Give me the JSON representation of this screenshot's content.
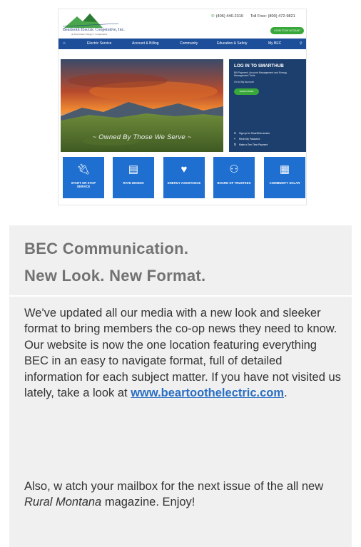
{
  "site": {
    "logo_name": "Beartooth Electric Cooperative, Inc.",
    "logo_tagline": "A Touchstone Energy® Cooperative",
    "phone": "(406) 446-2310",
    "toll_free": "Toll Free: (800) 472-9821",
    "login_label": "LOGIN TO MY ACCOUNT",
    "nav": [
      "Electric Service",
      "Account & Billing",
      "Community",
      "Education & Safety",
      "My BEC"
    ],
    "hero_caption": "~ Owned By Those We Serve ~",
    "smarthub": {
      "title": "LOG IN TO SMARTHUB",
      "description": "Bill Payment, Account Management and Energy Management Tools",
      "goto": "Go to My Account",
      "learn": "LEARN MORE",
      "links": [
        "Sign up for SmartHub access",
        "Reset My Password",
        "Make a One-Time Payment"
      ]
    },
    "tiles": [
      {
        "label": "START OR STOP SERVICE",
        "icon": "plug-icon"
      },
      {
        "label": "RATE DESIGN",
        "icon": "document-icon"
      },
      {
        "label": "ENERGY ASSISTANCE",
        "icon": "heart-hand-icon"
      },
      {
        "label": "BOARD OF TRUSTEES",
        "icon": "group-icon"
      },
      {
        "label": "COMMUNITY SOLAR",
        "icon": "solar-panel-icon"
      }
    ],
    "colors": {
      "nav": "#1c4e9a",
      "tile": "#1e6fd0",
      "accent_green": "#39a83a",
      "panel": "#1d3f6d"
    }
  },
  "article": {
    "heading_line1": "BEC Communication.",
    "heading_line2": "New Look. New Format.",
    "para1_before": "We've updated all our media with a new look and sleeker format to bring members the co-op news they need to know. Our website is now the one location featuring everything BEC in an easy to navigate format, full of detailed information for each subject matter. If you have not visited us lately, take a look at ",
    "link_text": "www.beartoothelectric.com",
    "para1_after": ".",
    "para2_before": "Also, w atch your mailbox for the next issue of the all new ",
    "magazine": "Rural Montana",
    "para2_after": " magazine. Enjoy!"
  }
}
